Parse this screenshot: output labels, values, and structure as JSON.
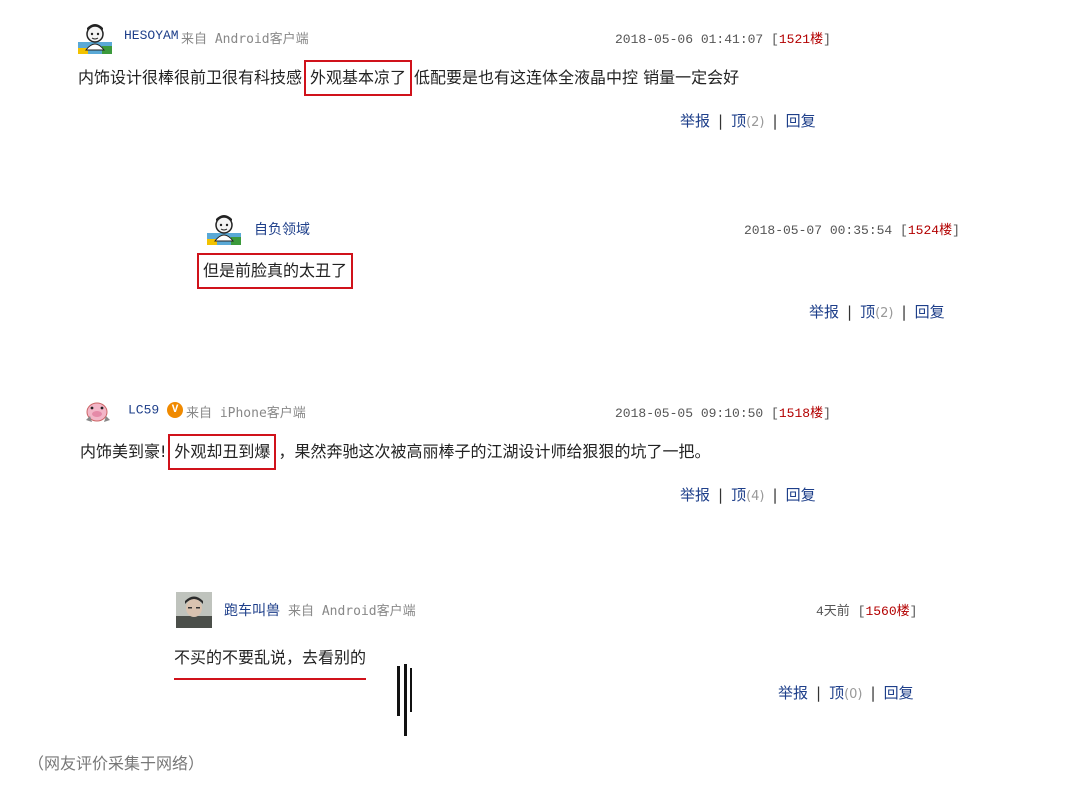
{
  "comments": [
    {
      "user": "HESOYAM",
      "source": "来自 Android客户端",
      "time": "2018-05-06 01:41:07",
      "floor": "1521楼",
      "text_before": "内饰设计很棒很前卫很有科技感",
      "highlight": "外观基本凉了",
      "text_after": "低配要是也有这连体全液晶中控  销量一定会好",
      "report": "举报",
      "top": "顶",
      "top_count": "(2)",
      "reply": "回复"
    },
    {
      "user": "自负领域",
      "time": "2018-05-07 00:35:54",
      "floor": "1524楼",
      "highlight": "但是前脸真的太丑了",
      "report": "举报",
      "top": "顶",
      "top_count": "(2)",
      "reply": "回复"
    },
    {
      "user": "LC59",
      "badge": "V",
      "source": "来自 iPhone客户端",
      "time": "2018-05-05 09:10:50",
      "floor": "1518楼",
      "text_before": "内饰美到豪!",
      "highlight": "外观却丑到爆",
      "text_after": "，果然奔驰这次被高丽棒子的江湖设计师给狠狠的坑了一把。",
      "report": "举报",
      "top": "顶",
      "top_count": "(4)",
      "reply": "回复"
    },
    {
      "user": "跑车叫兽",
      "source": "来自 Android客户端",
      "time": "4天前",
      "floor": "1560楼",
      "highlight": "不买的不要乱说，去看别的",
      "report": "举报",
      "top": "顶",
      "top_count": "(0)",
      "reply": "回复"
    }
  ],
  "footer_note": "（网友评价采集于网络）",
  "colors": {
    "highlight": "#d0121b",
    "link": "#1e3f8a",
    "floor": "#b30000"
  }
}
